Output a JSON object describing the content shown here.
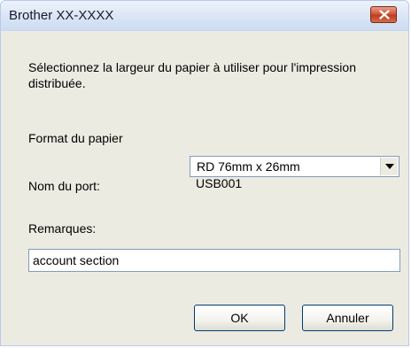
{
  "window": {
    "title": "Brother XX-XXXX",
    "close_icon": "close-icon"
  },
  "dialog": {
    "instruction": "Sélectionnez la largeur du papier à utiliser pour l'impression distribuée.",
    "paper_format_label": "Format du papier",
    "paper_format_value": "RD 76mm x 26mm",
    "port_label": "Nom du port:",
    "port_value": "USB001",
    "remarks_label": "Remarques:",
    "remarks_value": "account section"
  },
  "buttons": {
    "ok_label": "OK",
    "cancel_label": "Annuler"
  },
  "colors": {
    "close_button": "#d2573a",
    "dialog_background": "#ecebe2",
    "input_border": "#7f9db9"
  }
}
